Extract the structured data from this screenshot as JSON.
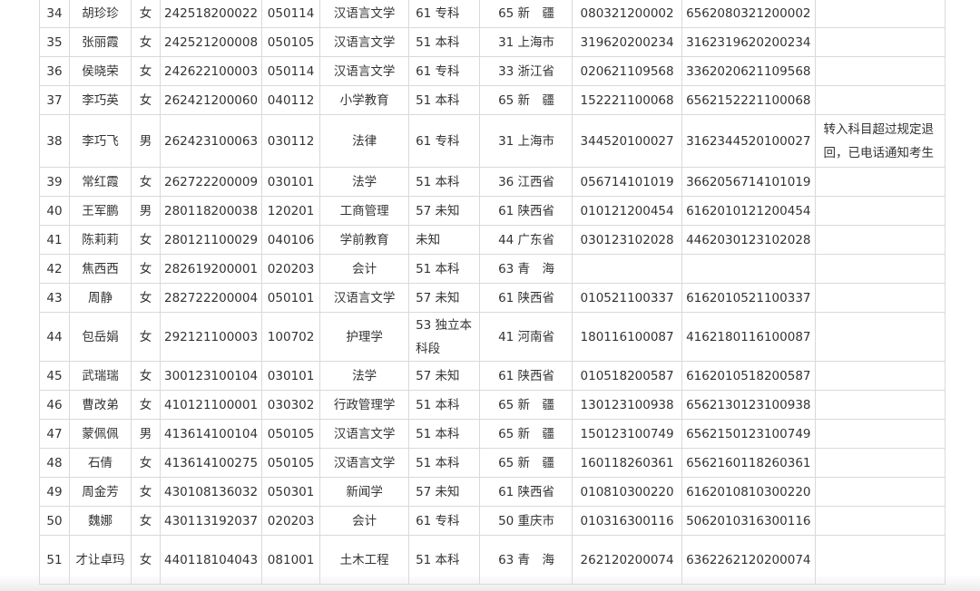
{
  "table": {
    "rows": [
      {
        "no": "34",
        "name": "胡珍珍",
        "gender": "女",
        "exam_id": "242518200022",
        "major_code": "050114",
        "major": "汉语言文学",
        "level": "61 专科",
        "province": "65 新　疆",
        "cert_no": "080321200002",
        "reg_no": "6562080321200002",
        "note": ""
      },
      {
        "no": "35",
        "name": "张丽霞",
        "gender": "女",
        "exam_id": "242521200008",
        "major_code": "050105",
        "major": "汉语言文学",
        "level": "51 本科",
        "province": "31 上海市",
        "cert_no": "319620200234",
        "reg_no": "3162319620200234",
        "note": ""
      },
      {
        "no": "36",
        "name": "侯晓荣",
        "gender": "女",
        "exam_id": "242622100003",
        "major_code": "050114",
        "major": "汉语言文学",
        "level": "61 专科",
        "province": "33 浙江省",
        "cert_no": "020621109568",
        "reg_no": "3362020621109568",
        "note": ""
      },
      {
        "no": "37",
        "name": "李巧英",
        "gender": "女",
        "exam_id": "262421200060",
        "major_code": "040112",
        "major": "小学教育",
        "level": "51 本科",
        "province": "65 新　疆",
        "cert_no": "152221100068",
        "reg_no": "6562152221100068",
        "note": ""
      },
      {
        "no": "38",
        "name": "李巧飞",
        "gender": "男",
        "exam_id": "262423100063",
        "major_code": "030112",
        "major": "法律",
        "level": "61 专科",
        "province": "31 上海市",
        "cert_no": "344520100027",
        "reg_no": "3162344520100027",
        "note": "转入科目超过规定退回，已电话通知考生"
      },
      {
        "no": "39",
        "name": "常红霞",
        "gender": "女",
        "exam_id": "262722200009",
        "major_code": "030101",
        "major": "法学",
        "level": "51 本科",
        "province": "36 江西省",
        "cert_no": "056714101019",
        "reg_no": "3662056714101019",
        "note": ""
      },
      {
        "no": "40",
        "name": "王军鹏",
        "gender": "男",
        "exam_id": "280118200038",
        "major_code": "120201",
        "major": "工商管理",
        "level": "57 未知",
        "province": "61 陕西省",
        "cert_no": "010121200454",
        "reg_no": "6162010121200454",
        "note": ""
      },
      {
        "no": "41",
        "name": "陈莉莉",
        "gender": "女",
        "exam_id": "280121100029",
        "major_code": "040106",
        "major": "学前教育",
        "level": "未知",
        "province": "44 广东省",
        "cert_no": "030123102028",
        "reg_no": "4462030123102028",
        "note": ""
      },
      {
        "no": "42",
        "name": "焦西西",
        "gender": "女",
        "exam_id": "282619200001",
        "major_code": "020203",
        "major": "会计",
        "level": "51 本科",
        "province": "63 青　海",
        "cert_no": "",
        "reg_no": "",
        "note": ""
      },
      {
        "no": "43",
        "name": "周静",
        "gender": "女",
        "exam_id": "282722200004",
        "major_code": "050101",
        "major": "汉语言文学",
        "level": "57 未知",
        "province": "61 陕西省",
        "cert_no": "010521100337",
        "reg_no": "6162010521100337",
        "note": ""
      },
      {
        "no": "44",
        "name": "包岳娟",
        "gender": "女",
        "exam_id": "292121100003",
        "major_code": "100702",
        "major": "护理学",
        "level": "53 独立本科段",
        "province": "41 河南省",
        "cert_no": "180116100087",
        "reg_no": "4162180116100087",
        "note": ""
      },
      {
        "no": "45",
        "name": "武瑞瑞",
        "gender": "女",
        "exam_id": "300123100104",
        "major_code": "030101",
        "major": "法学",
        "level": "57 未知",
        "province": "61 陕西省",
        "cert_no": "010518200587",
        "reg_no": "6162010518200587",
        "note": ""
      },
      {
        "no": "46",
        "name": "曹改弟",
        "gender": "女",
        "exam_id": "410121100001",
        "major_code": "030302",
        "major": "行政管理学",
        "level": "51 本科",
        "province": "65 新　疆",
        "cert_no": "130123100938",
        "reg_no": "6562130123100938",
        "note": ""
      },
      {
        "no": "47",
        "name": "蒙佩佩",
        "gender": "男",
        "exam_id": "413614100104",
        "major_code": "050105",
        "major": "汉语言文学",
        "level": "51 本科",
        "province": "65 新　疆",
        "cert_no": "150123100749",
        "reg_no": "6562150123100749",
        "note": ""
      },
      {
        "no": "48",
        "name": "石倩",
        "gender": "女",
        "exam_id": "413614100275",
        "major_code": "050105",
        "major": "汉语言文学",
        "level": "51 本科",
        "province": "65 新　疆",
        "cert_no": "160118260361",
        "reg_no": "6562160118260361",
        "note": ""
      },
      {
        "no": "49",
        "name": "周金芳",
        "gender": "女",
        "exam_id": "430108136032",
        "major_code": "050301",
        "major": "新闻学",
        "level": "57 未知",
        "province": "61 陕西省",
        "cert_no": "010810300220",
        "reg_no": "6162010810300220",
        "note": ""
      },
      {
        "no": "50",
        "name": "魏娜",
        "gender": "女",
        "exam_id": "430113192037",
        "major_code": "020203",
        "major": "会计",
        "level": "61 专科",
        "province": "50 重庆市",
        "cert_no": "010316300116",
        "reg_no": "5062010316300116",
        "note": ""
      },
      {
        "no": "51",
        "name": "才让卓玛",
        "gender": "女",
        "exam_id": "440118104043",
        "major_code": "081001",
        "major": "土木工程",
        "level": "51 本科",
        "province": "63 青　海",
        "cert_no": "262120200074",
        "reg_no": "6362262120200074",
        "note": ""
      }
    ]
  }
}
